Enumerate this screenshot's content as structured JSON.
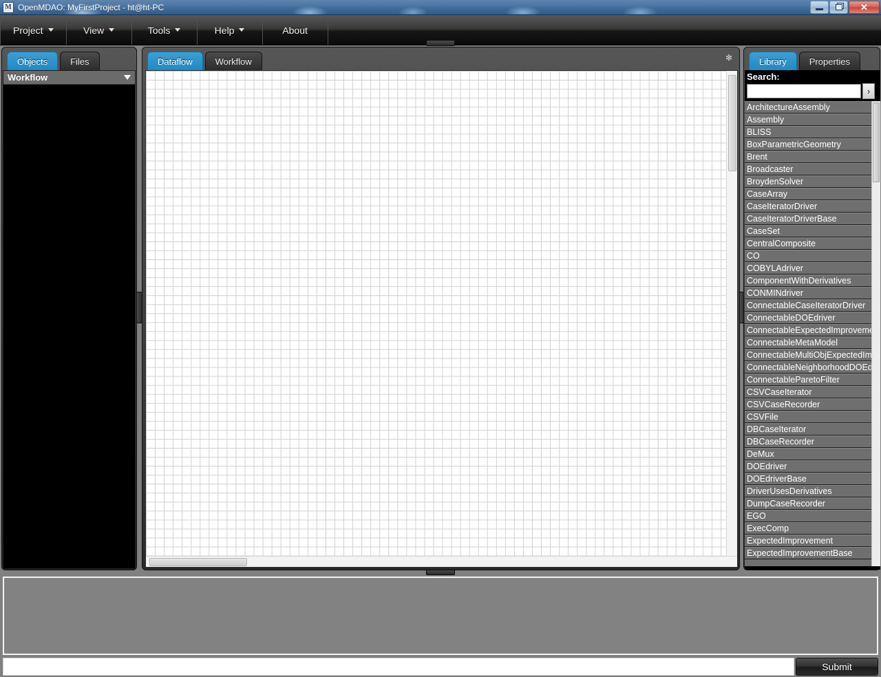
{
  "window": {
    "title": "OpenMDAO: MyFirstProject - ht@ht-PC",
    "app_icon": "M",
    "minimize_label": "",
    "restore_label": "",
    "close_label": "✕"
  },
  "menubar": {
    "items": [
      {
        "label": "Project",
        "has_caret": true
      },
      {
        "label": "View",
        "has_caret": true
      },
      {
        "label": "Tools",
        "has_caret": true
      },
      {
        "label": "Help",
        "has_caret": true
      },
      {
        "label": "About",
        "has_caret": false
      }
    ]
  },
  "left_panel": {
    "tabs": [
      {
        "label": "Objects",
        "active": true
      },
      {
        "label": "Files",
        "active": false
      }
    ],
    "section": {
      "title": "Workflow",
      "collapse_icon": "chevron-down-icon"
    }
  },
  "center_panel": {
    "tabs": [
      {
        "label": "Dataflow",
        "active": true
      },
      {
        "label": "Workflow",
        "active": false
      }
    ],
    "pin_icon": "pin-icon",
    "pin_glyph": "✻"
  },
  "right_panel": {
    "tabs": [
      {
        "label": "Library",
        "active": true
      },
      {
        "label": "Properties",
        "active": false
      }
    ],
    "search": {
      "label": "Search:",
      "value": "",
      "placeholder": "",
      "go_glyph": "›",
      "go_icon": "chevron-right-icon"
    },
    "library_items": [
      "ArchitectureAssembly",
      "Assembly",
      "BLISS",
      "BoxParametricGeometry",
      "Brent",
      "Broadcaster",
      "BroydenSolver",
      "CaseArray",
      "CaseIteratorDriver",
      "CaseIteratorDriverBase",
      "CaseSet",
      "CentralComposite",
      "CO",
      "COBYLAdriver",
      "ComponentWithDerivatives",
      "CONMINdriver",
      "ConnectableCaseIteratorDriver",
      "ConnectableDOEdriver",
      "ConnectableExpectedImprovement",
      "ConnectableMetaModel",
      "ConnectableMultiObjExpectedImprovement",
      "ConnectableNeighborhoodDOEdriver",
      "ConnectableParetoFilter",
      "CSVCaseIterator",
      "CSVCaseRecorder",
      "CSVFile",
      "DBCaseIterator",
      "DBCaseRecorder",
      "DeMux",
      "DOEdriver",
      "DOEdriverBase",
      "DriverUsesDerivatives",
      "DumpCaseRecorder",
      "EGO",
      "ExecComp",
      "ExpectedImprovement",
      "ExpectedImprovementBase"
    ]
  },
  "console": {
    "output": "",
    "input_value": "",
    "input_placeholder": "",
    "submit_label": "Submit"
  },
  "colors": {
    "accent_tab": "#2389c4",
    "titlebar_blue": "#4a76a3",
    "panel_dark": "#3c3c3c",
    "list_gray": "#6f6f6f",
    "console_gray": "#828282"
  }
}
